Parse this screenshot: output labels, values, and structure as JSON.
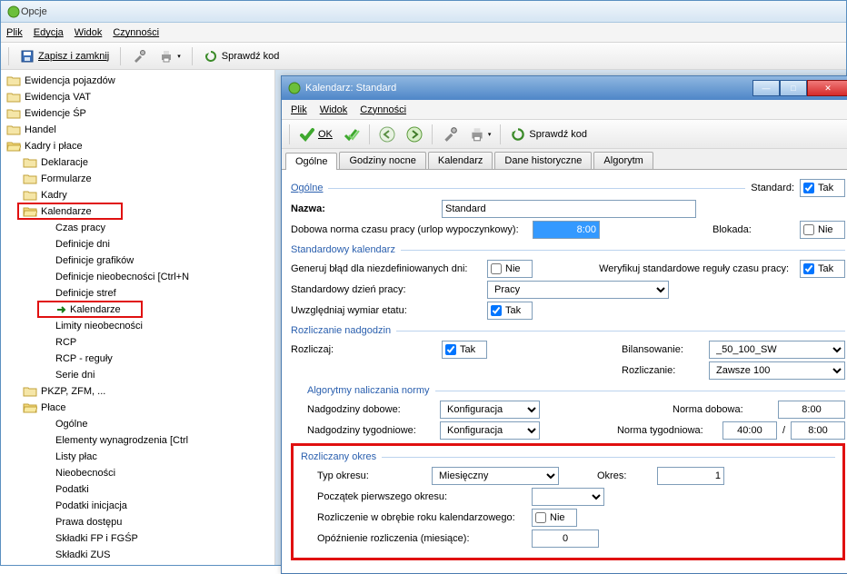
{
  "mainWindow": {
    "title": "Opcje",
    "menu": {
      "plik": "Plik",
      "edycja": "Edycja",
      "widok": "Widok",
      "czynnosci": "Czynności"
    },
    "toolbar": {
      "saveClose": "Zapisz i zamknij",
      "check": "Sprawdź kod"
    }
  },
  "tree": {
    "items": [
      {
        "label": "Ewidencja pojazdów",
        "depth": 0
      },
      {
        "label": "Ewidencja VAT",
        "depth": 0
      },
      {
        "label": "Ewidencje ŚP",
        "depth": 0
      },
      {
        "label": "Handel",
        "depth": 0
      },
      {
        "label": "Kadry i płace",
        "depth": 0
      },
      {
        "label": "Deklaracje",
        "depth": 1
      },
      {
        "label": "Formularze",
        "depth": 1
      },
      {
        "label": "Kadry",
        "depth": 1
      },
      {
        "label": "Kalendarze",
        "depth": 1,
        "hl": true
      },
      {
        "label": "Czas pracy",
        "depth": 2
      },
      {
        "label": "Definicje dni",
        "depth": 2
      },
      {
        "label": "Definicje grafików",
        "depth": 2
      },
      {
        "label": "Definicje nieobecności [Ctrl+N",
        "depth": 2
      },
      {
        "label": "Definicje stref",
        "depth": 2
      },
      {
        "label": "Kalendarze",
        "depth": 2,
        "hl": true,
        "arrow": true
      },
      {
        "label": "Limity nieobecności",
        "depth": 2
      },
      {
        "label": "RCP",
        "depth": 2
      },
      {
        "label": "RCP - reguły",
        "depth": 2
      },
      {
        "label": "Serie dni",
        "depth": 2
      },
      {
        "label": "PKZP, ZFM, ...",
        "depth": 1
      },
      {
        "label": "Płace",
        "depth": 1
      },
      {
        "label": "Ogólne",
        "depth": 2
      },
      {
        "label": "Elementy wynagrodzenia [Ctrl",
        "depth": 2
      },
      {
        "label": "Listy płac",
        "depth": 2
      },
      {
        "label": "Nieobecności",
        "depth": 2
      },
      {
        "label": "Podatki",
        "depth": 2
      },
      {
        "label": "Podatki inicjacja",
        "depth": 2
      },
      {
        "label": "Prawa dostępu",
        "depth": 2
      },
      {
        "label": "Składki FP i FGŚP",
        "depth": 2
      },
      {
        "label": "Składki ZUS",
        "depth": 2
      }
    ]
  },
  "subWindow": {
    "title": "Kalendarz: Standard",
    "menu": {
      "plik": "Plik",
      "widok": "Widok",
      "czynnosci": "Czynności"
    },
    "toolbar": {
      "ok": "OK",
      "check": "Sprawdź kod"
    },
    "tabs": [
      "Ogólne",
      "Godziny nocne",
      "Kalendarz",
      "Dane historyczne",
      "Algorytm"
    ],
    "activeTab": 0
  },
  "form": {
    "groups": {
      "ogolne": "Ogólne",
      "stdkal": "Standardowy kalendarz",
      "rozNad": "Rozliczanie nadgodzin",
      "algNorm": "Algorytmy naliczania normy",
      "rozOkr": "Rozliczany okres"
    },
    "labels": {
      "standard": "Standard:",
      "tak": "Tak",
      "nie": "Nie",
      "nazwa": "Nazwa:",
      "dobowa": "Dobowa norma czasu pracy (urlop wypoczynkowy):",
      "blokada": "Blokada:",
      "genblad": "Generuj błąd dla niezdefiniowanych dni:",
      "weryf": "Weryfikuj standardowe reguły czasu pracy:",
      "stdDzien": "Standardowy dzień pracy:",
      "uwzgEtat": "Uwzględniaj wymiar etatu:",
      "rozliczaj": "Rozliczaj:",
      "bilans": "Bilansowanie:",
      "rozliczanie": "Rozliczanie:",
      "nadDob": "Nadgodziny dobowe:",
      "normDob": "Norma dobowa:",
      "nadTyg": "Nadgodziny tygodniowe:",
      "normTyg": "Norma tygodniowa:",
      "typOkr": "Typ okresu:",
      "okres": "Okres:",
      "poczatek": "Początek pierwszego okresu:",
      "rozRok": "Rozliczenie w obrębie roku kalendarzowego:",
      "opoz": "Opóźnienie rozliczenia (miesiące):"
    },
    "values": {
      "nazwa": "Standard",
      "dobowa": "8:00",
      "stdDzien": "Pracy",
      "bilans": "_50_100_SW",
      "rozliczanie": "Zawsze 100",
      "nadDob": "Konfiguracja",
      "nadTyg": "Konfiguracja",
      "normDob": "8:00",
      "normTyg1": "40:00",
      "normTyg2": "8:00",
      "typOkr": "Miesięczny",
      "okres": "1",
      "poczatek": "",
      "opoz": "0",
      "slash": "/"
    }
  }
}
